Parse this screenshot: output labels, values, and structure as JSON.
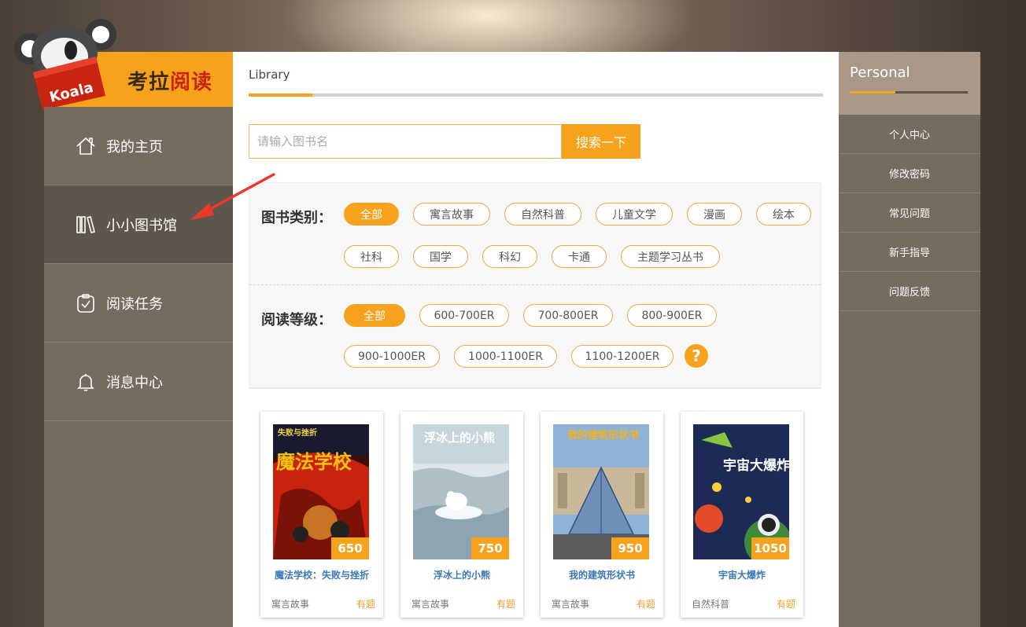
{
  "brand": {
    "name_a": "考拉",
    "name_b": "阅读",
    "mascot_label": "Koala"
  },
  "sidebar": {
    "items": [
      {
        "label": "我的主页",
        "icon": "home-icon"
      },
      {
        "label": "小小图书馆",
        "icon": "library-icon",
        "active": true
      },
      {
        "label": "阅读任务",
        "icon": "task-icon"
      },
      {
        "label": "消息中心",
        "icon": "bell-icon"
      }
    ]
  },
  "main": {
    "tab": {
      "label": "Library"
    },
    "search": {
      "placeholder": "请输入图书名",
      "button": "搜索一下"
    },
    "categories": {
      "label": "图书类别：",
      "options": [
        "全部",
        "寓言故事",
        "自然科普",
        "儿童文学",
        "漫画",
        "绘本",
        "社科",
        "国学",
        "科幻",
        "卡通",
        "主题学习丛书"
      ],
      "selected": "全部"
    },
    "levels": {
      "label": "阅读等级：",
      "options": [
        "全部",
        "600-700ER",
        "700-800ER",
        "800-900ER",
        "900-1000ER",
        "1000-1100ER",
        "1100-1200ER"
      ],
      "selected": "全部",
      "help": "?"
    },
    "books": [
      {
        "title": "魔法学校：失败与挫折",
        "level": "650",
        "category": "寓言故事",
        "tag": "有题",
        "cover_title": "魔法学校",
        "cover_sub": "失败与挫折"
      },
      {
        "title": "浮冰上的小熊",
        "level": "750",
        "category": "寓言故事",
        "tag": "有题",
        "cover_title": "浮冰上的小熊"
      },
      {
        "title": "我的建筑形状书",
        "level": "950",
        "category": "寓言故事",
        "tag": "有题",
        "cover_title": "我的建筑形状书"
      },
      {
        "title": "宇宙大爆炸",
        "level": "1050",
        "category": "自然科普",
        "tag": "有题",
        "cover_title": "宇宙大爆炸"
      }
    ]
  },
  "personal": {
    "title": "Personal",
    "items": [
      "个人中心",
      "修改密码",
      "常见问题",
      "新手指导",
      "问题反馈"
    ]
  },
  "colors": {
    "accent": "#f7a21c",
    "nav": "#756b5f",
    "nav_active": "#5e564d",
    "title_link": "#3b78b8",
    "arrow": "#e8392b"
  }
}
